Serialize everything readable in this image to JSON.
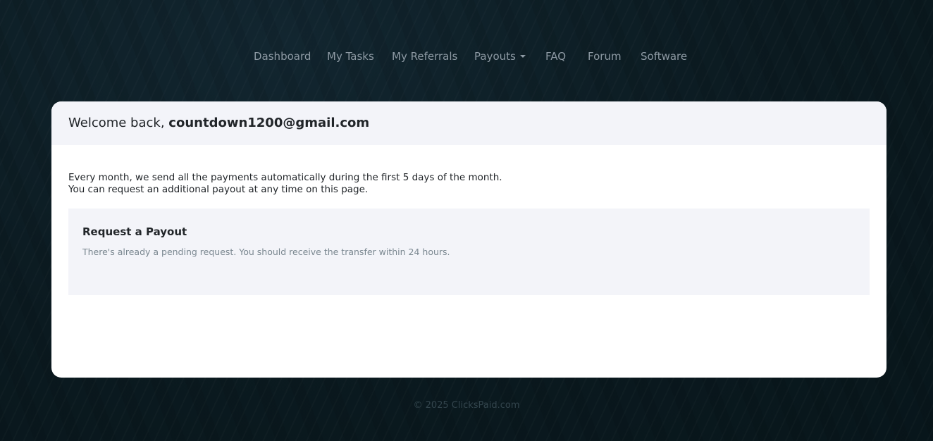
{
  "nav": {
    "items": [
      {
        "label": "Dashboard"
      },
      {
        "label": "My Tasks"
      },
      {
        "label": "My Referrals"
      },
      {
        "label": "Payouts",
        "has_dropdown": true
      },
      {
        "label": "FAQ"
      },
      {
        "label": "Forum"
      },
      {
        "label": "Software"
      }
    ],
    "link_color": "#8e9aa4"
  },
  "card": {
    "welcome_prefix": "Welcome back,",
    "user_email": "countdown1200@gmail.com",
    "info_line_1": "Every month, we send all the payments automatically during the first 5 days of the month.",
    "info_line_2": "You can request an additional payout at any time on this page.",
    "payout": {
      "title": "Request a Payout",
      "status_note": "There's already a pending request. You should receive the transfer within 24 hours."
    }
  },
  "footer": {
    "copyright": "© 2025 ClicksPaid.com"
  },
  "colors": {
    "background": "#0c1b21",
    "card_header_bg": "#f3f4f9",
    "payout_box_bg": "#f3f4f9"
  }
}
